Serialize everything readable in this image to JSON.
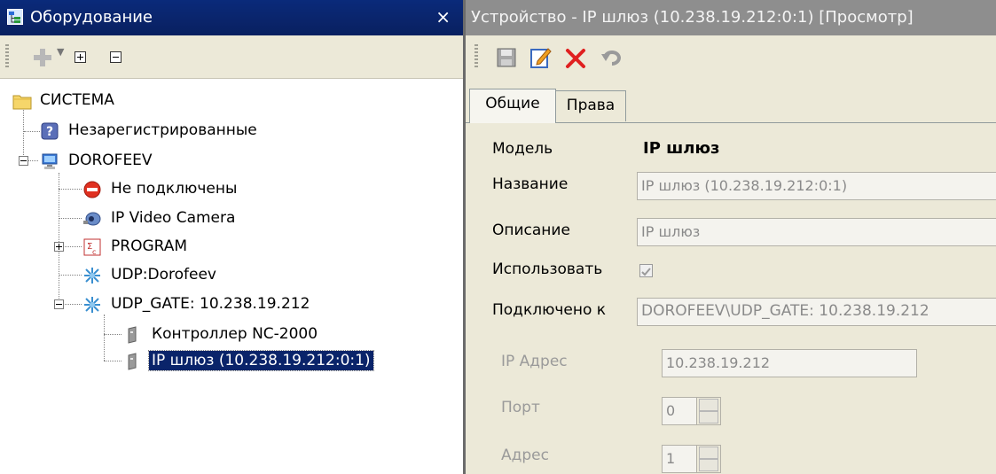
{
  "left_panel": {
    "title": "Оборудование",
    "close_glyph": "×",
    "toolbar": {
      "add_icon": "add-icon",
      "dropdown_glyph": "▼",
      "expand_all": "expand-all-icon",
      "collapse_all": "collapse-all-icon"
    },
    "tree": {
      "root": "СИСТЕМА",
      "unregistered": "Незарегистрированные",
      "host": "DOROFEEV",
      "not_connected": "Не подключены",
      "ip_camera": "IP Video Camera",
      "program": "PROGRAM",
      "udp_dorofeev": "UDP:Dorofeev",
      "udp_gate": "UDP_GATE: 10.238.19.212",
      "controller": "Контроллер NC-2000",
      "ip_gateway": "IP шлюз (10.238.19.212:0:1)"
    }
  },
  "right_panel": {
    "title": "Устройство - IP шлюз (10.238.19.212:0:1) [Просмотр]",
    "toolbar": {
      "save_icon": "save-icon",
      "edit_icon": "edit-icon",
      "delete_icon": "delete-icon",
      "undo_icon": "undo-icon"
    },
    "tabs": [
      "Общие",
      "Права"
    ],
    "fields": {
      "model_label": "Модель",
      "model_value": "IP шлюз",
      "name_label": "Название",
      "name_value": "IP шлюз (10.238.19.212:0:1)",
      "desc_label": "Описание",
      "desc_value": "IP шлюз",
      "use_label": "Использовать",
      "use_checked": true,
      "connected_label": "Подключено к",
      "connected_value": "DOROFEEV\\UDP_GATE: 10.238.19.212",
      "ip_label": "IP Адрес",
      "ip_value": "10.238.19.212",
      "port_label": "Порт",
      "port_value": "0",
      "addr_label": "Адрес",
      "addr_value": "1"
    }
  },
  "colors": {
    "selection": "#0a246a",
    "title_active": "#0a246a",
    "title_inactive": "#8e8e8e",
    "panel_bg": "#ece9d8",
    "delete_red": "#e02020"
  }
}
